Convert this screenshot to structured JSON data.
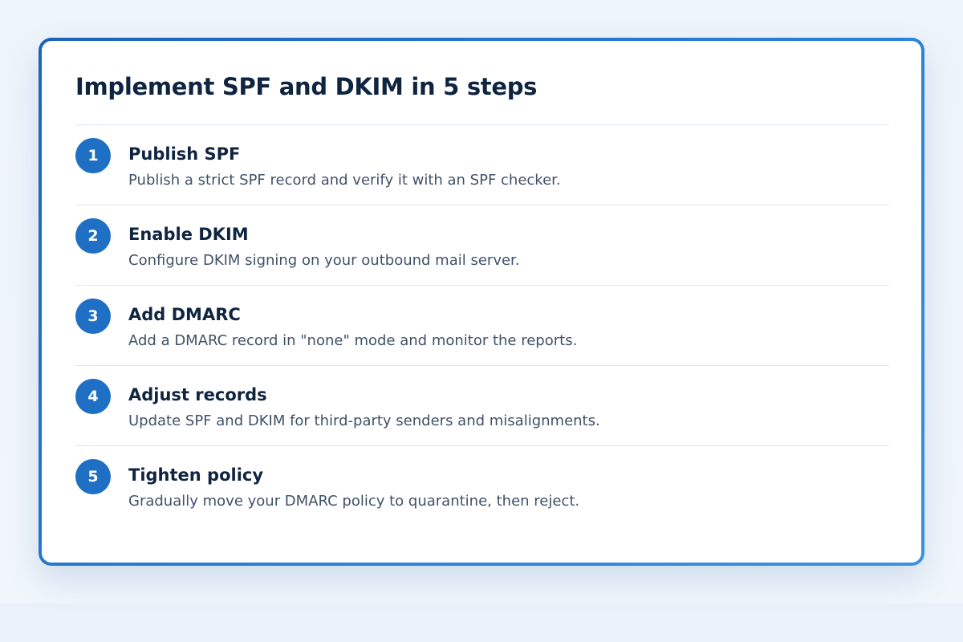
{
  "card": {
    "title": "Implement SPF and DKIM in 5 steps"
  },
  "steps": [
    {
      "number": "1",
      "title": "Publish SPF",
      "description": "Publish a strict SPF record and verify it with an SPF checker."
    },
    {
      "number": "2",
      "title": "Enable DKIM",
      "description": "Configure DKIM signing on your outbound mail server."
    },
    {
      "number": "3",
      "title": "Add DMARC",
      "description": "Add a DMARC record in \"none\" mode and monitor the reports."
    },
    {
      "number": "4",
      "title": "Adjust records",
      "description": "Update SPF and DKIM for third-party senders and misalignments."
    },
    {
      "number": "5",
      "title": "Tighten policy",
      "description": "Gradually move your DMARC policy to quarantine, then reject."
    }
  ],
  "colors": {
    "accent": "#1f6fc5",
    "border_gradient_start": "#1c64b8",
    "border_gradient_end": "#3a92e4",
    "heading_text": "#0f2440",
    "body_text": "#3f5269",
    "page_background": "#eef4fb"
  }
}
